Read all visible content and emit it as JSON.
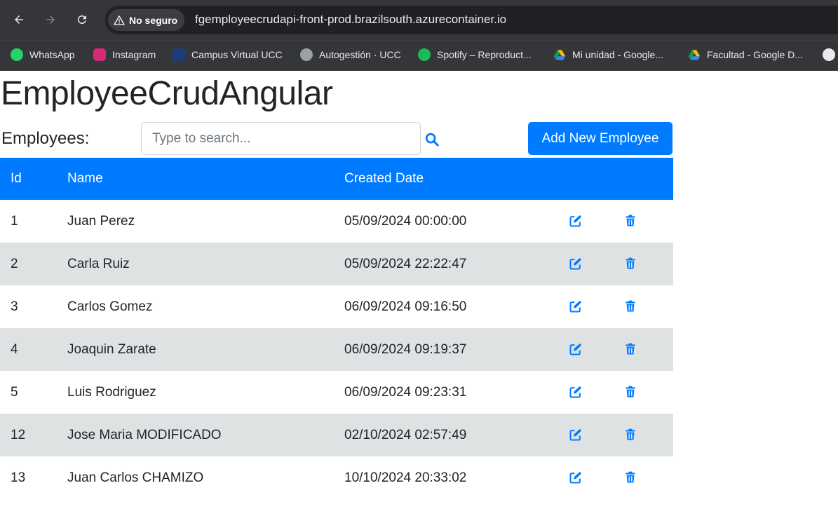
{
  "browser": {
    "security_label": "No seguro",
    "url": "fgemployeecrudapi-front-prod.brazilsouth.azurecontainer.io"
  },
  "bookmarks": [
    {
      "label": "WhatsApp",
      "icon": "whatsapp-icon",
      "color": "#25d366"
    },
    {
      "label": "Instagram",
      "icon": "instagram-icon",
      "color": "#d62976"
    },
    {
      "label": "Campus Virtual UCC",
      "icon": "campus-icon",
      "color": "#1d3c7a"
    },
    {
      "label": "Autogestión · UCC",
      "icon": "globe-icon",
      "color": "#9aa0a6"
    },
    {
      "label": "Spotify – Reproduct...",
      "icon": "spotify-icon",
      "color": "#1db954"
    },
    {
      "label": "Mi unidad - Google...",
      "icon": "google-drive-icon",
      "color": "#fbbc04"
    },
    {
      "label": "Facultad - Google D...",
      "icon": "google-drive-icon",
      "color": "#fbbc04"
    }
  ],
  "page": {
    "title": "EmployeeCrudAngular",
    "employees_label": "Employees:",
    "search_placeholder": "Type to search...",
    "add_button": "Add New Employee"
  },
  "table": {
    "headers": [
      "Id",
      "Name",
      "Created Date"
    ],
    "rows": [
      {
        "id": "1",
        "name": "Juan Perez",
        "created": "05/09/2024 00:00:00"
      },
      {
        "id": "2",
        "name": "Carla Ruiz",
        "created": "05/09/2024 22:22:47"
      },
      {
        "id": "3",
        "name": "Carlos Gomez",
        "created": "06/09/2024 09:16:50"
      },
      {
        "id": "4",
        "name": "Joaquin Zarate",
        "created": "06/09/2024 09:19:37"
      },
      {
        "id": "5",
        "name": "Luis Rodriguez",
        "created": "06/09/2024 09:23:31"
      },
      {
        "id": "12",
        "name": "Jose Maria MODIFICADO",
        "created": "02/10/2024 02:57:49"
      },
      {
        "id": "13",
        "name": "Juan Carlos CHAMIZO",
        "created": "10/10/2024 20:33:02"
      }
    ]
  },
  "colors": {
    "primary": "#007bff",
    "row_alt": "#dee2e2",
    "chrome": "#35363a"
  }
}
